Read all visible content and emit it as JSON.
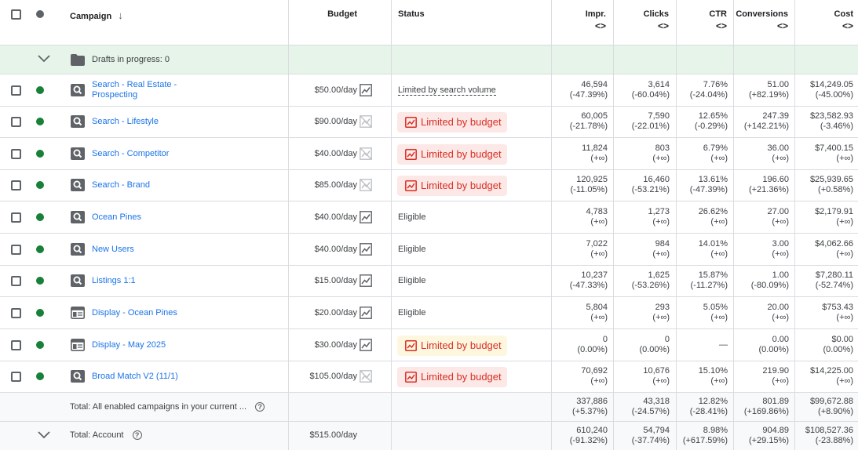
{
  "header": {
    "campaign": "Campaign",
    "budget": "Budget",
    "status": "Status",
    "impr": "Impr.",
    "clicks": "Clicks",
    "ctr": "CTR",
    "conversions": "Conversions",
    "cost": "Cost",
    "sort_icon": "↓",
    "expand_icon": "<>"
  },
  "drafts": {
    "label": "Drafts in progress: 0"
  },
  "rows": [
    {
      "name_line1": "Search - Real Estate -",
      "name_line2": "Prospecting",
      "type": "search",
      "budget": "$50.00/day",
      "chart_enabled": true,
      "status": "Limited by search volume",
      "status_kind": "text-dashed",
      "impr": "46,594",
      "impr_chg": "(-47.39%)",
      "clicks": "3,614",
      "clicks_chg": "(-60.04%)",
      "ctr": "7.76%",
      "ctr_chg": "(-24.04%)",
      "conv": "51.00",
      "conv_chg": "(+82.19%)",
      "cost": "$14,249.05",
      "cost_chg": "(-45.00%)"
    },
    {
      "name_line1": "Search - Lifestyle",
      "name_line2": "",
      "type": "search",
      "budget": "$90.00/day",
      "chart_enabled": false,
      "status": "Limited by budget",
      "status_kind": "red",
      "impr": "60,005",
      "impr_chg": "(-21.78%)",
      "clicks": "7,590",
      "clicks_chg": "(-22.01%)",
      "ctr": "12.65%",
      "ctr_chg": "(-0.29%)",
      "conv": "247.39",
      "conv_chg": "(+142.21%)",
      "cost": "$23,582.93",
      "cost_chg": "(-3.46%)"
    },
    {
      "name_line1": "Search - Competitor",
      "name_line2": "",
      "type": "search",
      "budget": "$40.00/day",
      "chart_enabled": false,
      "status": "Limited by budget",
      "status_kind": "red",
      "impr": "11,824",
      "impr_chg": "(+∞)",
      "clicks": "803",
      "clicks_chg": "(+∞)",
      "ctr": "6.79%",
      "ctr_chg": "(+∞)",
      "conv": "36.00",
      "conv_chg": "(+∞)",
      "cost": "$7,400.15",
      "cost_chg": "(+∞)"
    },
    {
      "name_line1": "Search - Brand",
      "name_line2": "",
      "type": "search",
      "budget": "$85.00/day",
      "chart_enabled": false,
      "status": "Limited by budget",
      "status_kind": "red",
      "impr": "120,925",
      "impr_chg": "(-11.05%)",
      "clicks": "16,460",
      "clicks_chg": "(-53.21%)",
      "ctr": "13.61%",
      "ctr_chg": "(-47.39%)",
      "conv": "196.60",
      "conv_chg": "(+21.36%)",
      "cost": "$25,939.65",
      "cost_chg": "(+0.58%)"
    },
    {
      "name_line1": "Ocean Pines",
      "name_line2": "",
      "type": "search",
      "budget": "$40.00/day",
      "chart_enabled": true,
      "status": "Eligible",
      "status_kind": "text",
      "impr": "4,783",
      "impr_chg": "(+∞)",
      "clicks": "1,273",
      "clicks_chg": "(+∞)",
      "ctr": "26.62%",
      "ctr_chg": "(+∞)",
      "conv": "27.00",
      "conv_chg": "(+∞)",
      "cost": "$2,179.91",
      "cost_chg": "(+∞)"
    },
    {
      "name_line1": "New Users",
      "name_line2": "",
      "type": "search",
      "budget": "$40.00/day",
      "chart_enabled": true,
      "status": "Eligible",
      "status_kind": "text",
      "impr": "7,022",
      "impr_chg": "(+∞)",
      "clicks": "984",
      "clicks_chg": "(+∞)",
      "ctr": "14.01%",
      "ctr_chg": "(+∞)",
      "conv": "3.00",
      "conv_chg": "(+∞)",
      "cost": "$4,062.66",
      "cost_chg": "(+∞)"
    },
    {
      "name_line1": "Listings 1:1",
      "name_line2": "",
      "type": "search",
      "budget": "$15.00/day",
      "chart_enabled": true,
      "status": "Eligible",
      "status_kind": "text",
      "impr": "10,237",
      "impr_chg": "(-47.33%)",
      "clicks": "1,625",
      "clicks_chg": "(-53.26%)",
      "ctr": "15.87%",
      "ctr_chg": "(-11.27%)",
      "conv": "1.00",
      "conv_chg": "(-80.09%)",
      "cost": "$7,280.11",
      "cost_chg": "(-52.74%)"
    },
    {
      "name_line1": "Display - Ocean Pines",
      "name_line2": "",
      "type": "display",
      "budget": "$20.00/day",
      "chart_enabled": true,
      "status": "Eligible",
      "status_kind": "text",
      "impr": "5,804",
      "impr_chg": "(+∞)",
      "clicks": "293",
      "clicks_chg": "(+∞)",
      "ctr": "5.05%",
      "ctr_chg": "(+∞)",
      "conv": "20.00",
      "conv_chg": "(+∞)",
      "cost": "$753.43",
      "cost_chg": "(+∞)"
    },
    {
      "name_line1": "Display - May 2025",
      "name_line2": "",
      "type": "display",
      "budget": "$30.00/day",
      "chart_enabled": true,
      "status": "Limited by budget",
      "status_kind": "yellow",
      "impr": "0",
      "impr_chg": "(0.00%)",
      "clicks": "0",
      "clicks_chg": "(0.00%)",
      "ctr": "—",
      "ctr_chg": "",
      "conv": "0.00",
      "conv_chg": "(0.00%)",
      "cost": "$0.00",
      "cost_chg": "(0.00%)"
    },
    {
      "name_line1": "Broad Match V2 (11/1)",
      "name_line2": "",
      "type": "search",
      "budget": "$105.00/day",
      "chart_enabled": false,
      "status": "Limited by budget",
      "status_kind": "red",
      "impr": "70,692",
      "impr_chg": "(+∞)",
      "clicks": "10,676",
      "clicks_chg": "(+∞)",
      "ctr": "15.10%",
      "ctr_chg": "(+∞)",
      "conv": "219.90",
      "conv_chg": "(+∞)",
      "cost": "$14,225.00",
      "cost_chg": "(+∞)"
    }
  ],
  "total_enabled": {
    "label": "Total: All enabled campaigns in your current ...",
    "help": "?",
    "impr": "337,886",
    "impr_chg": "(+5.37%)",
    "clicks": "43,318",
    "clicks_chg": "(-24.57%)",
    "ctr": "12.82%",
    "ctr_chg": "(-28.41%)",
    "conv": "801.89",
    "conv_chg": "(+169.86%)",
    "cost": "$99,672.88",
    "cost_chg": "(+8.90%)"
  },
  "total_account": {
    "label": "Total: Account",
    "help": "?",
    "budget": "$515.00/day",
    "impr": "610,240",
    "impr_chg": "(-91.32%)",
    "clicks": "54,794",
    "clicks_chg": "(-37.74%)",
    "ctr": "8.98%",
    "ctr_chg": "(+617.59%)",
    "conv": "904.89",
    "conv_chg": "(+29.15%)",
    "cost": "$108,527.36",
    "cost_chg": "(-23.88%)"
  },
  "colors": {
    "link": "#1a73e8",
    "enabled_dot": "#188038",
    "drafts_bg": "#e6f4ea",
    "limited_red_bg": "#fce8e6",
    "limited_yellow_bg": "#fef7e0",
    "limited_text": "#d93025"
  }
}
